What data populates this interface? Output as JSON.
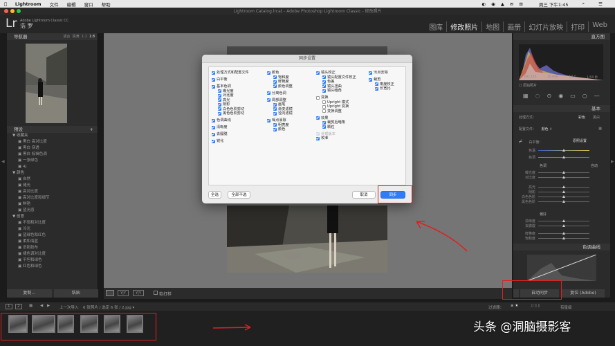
{
  "menubar": {
    "app": "Lightroom",
    "items": [
      "文件",
      "编辑",
      "窗口",
      "帮助"
    ],
    "clock": "周三 下午1:45"
  },
  "window": {
    "title": "Lightroom Catalog.lrcat - Adobe Photoshop Lightroom Classic - 修改照片"
  },
  "identity": {
    "logo": "Lr",
    "product": "Adobe Lightroom Classic CC",
    "user": "浩 罗"
  },
  "modules": [
    "图库",
    "修改照片",
    "地图",
    "画册",
    "幻灯片放映",
    "打印",
    "Web"
  ],
  "left_panel": {
    "navigator_label": "导航器",
    "navigator_zoom": [
      "适合",
      "填满",
      "1:1",
      "1:8"
    ],
    "presets_label": "预设",
    "preset_groups": [
      {
        "name": "收藏夹",
        "items": [
          "黑白 高对比度",
          "黑白 穿透",
          "黑白 棕褐色调",
          "一张绿色",
          "4J"
        ]
      },
      {
        "name": "颜色",
        "items": [
          "自然",
          "褪光",
          "高对比度",
          "高对比度和细节",
          "鲜艳",
          "蓝光感"
        ]
      },
      {
        "name": "创意",
        "items": [
          "不饱和对比度",
          "冷光",
          "蓝绿色和红色",
          "柔和海蓝",
          "旧影胶布",
          "褪色调对比度",
          "平坦和绿色",
          "红色和绿色"
        ]
      }
    ],
    "copy_btn": "复制...",
    "paste_btn": "粘贴"
  },
  "toolbar": {
    "soft_proof": "软打样"
  },
  "right_panel": {
    "histogram_label": "直方图",
    "histo_info": [
      "ISO 125",
      "35 mm",
      "f/4.0",
      "1/50 秒"
    ],
    "original_photo": "原始照片",
    "basic_label": "基本",
    "treatment": "处理方式：",
    "treatment_opts": [
      "彩色",
      "黑白"
    ],
    "profile_label": "配置文件：",
    "profile_value": "颜色",
    "wb_label": "白平衡：",
    "wb_value": "原照设置",
    "tone_label": "色调",
    "tone_auto": "自动",
    "presence_label": "偏好",
    "sliders": [
      "色温",
      "色调",
      "曝光度",
      "对比度",
      "高光",
      "阴影",
      "白色色阶",
      "黑色色阶",
      "清晰度",
      "去朦胧",
      "鲜艳度",
      "饱和度"
    ],
    "tone_curve_label": "色调曲线",
    "auto_sync_btn": "自动同步",
    "reset_btn": "复位 (Adobe)"
  },
  "filmstrip_bar": {
    "pages": [
      "1",
      "2"
    ],
    "source": "上一次导入",
    "count": "6 张照片 / 选定 6 张 / 2.jpg ▾",
    "filter_label": "过滤器：",
    "filter_value": "有星级"
  },
  "dialog": {
    "title": "同步设置",
    "col1": [
      {
        "label": "处理方式和配置文件",
        "checked": true,
        "indent": 0
      },
      {
        "label": "白平衡",
        "checked": true,
        "indent": 0
      },
      {
        "label": "基本色调",
        "checked": true,
        "indent": 0
      },
      {
        "label": "曝光度",
        "checked": true,
        "indent": 1
      },
      {
        "label": "对比度",
        "checked": true,
        "indent": 1
      },
      {
        "label": "高光",
        "checked": true,
        "indent": 1
      },
      {
        "label": "阴影",
        "checked": true,
        "indent": 1
      },
      {
        "label": "白色色阶剪切",
        "checked": true,
        "indent": 1
      },
      {
        "label": "黑色色阶剪切",
        "checked": true,
        "indent": 1
      },
      {
        "label": "色调曲线",
        "checked": true,
        "indent": 0
      },
      {
        "label": "清晰度",
        "checked": true,
        "indent": 0
      },
      {
        "label": "去朦胧",
        "checked": true,
        "indent": 0
      },
      {
        "label": "锐化",
        "checked": true,
        "indent": 0
      }
    ],
    "col2": [
      {
        "label": "颜色",
        "checked": true,
        "indent": 0
      },
      {
        "label": "饱和度",
        "checked": true,
        "indent": 1
      },
      {
        "label": "鲜艳度",
        "checked": true,
        "indent": 1
      },
      {
        "label": "颜色调整",
        "checked": true,
        "indent": 1
      },
      {
        "label": "分离色调",
        "checked": true,
        "indent": 0
      },
      {
        "label": "局部调整",
        "checked": true,
        "indent": 0
      },
      {
        "label": "画笔",
        "checked": true,
        "indent": 1
      },
      {
        "label": "渐变滤镜",
        "checked": true,
        "indent": 1
      },
      {
        "label": "径向滤镜",
        "checked": true,
        "indent": 1
      },
      {
        "label": "噪点消除",
        "checked": true,
        "indent": 0
      },
      {
        "label": "明亮度",
        "checked": true,
        "indent": 1
      },
      {
        "label": "颜色",
        "checked": true,
        "indent": 1
      }
    ],
    "col3": [
      {
        "label": "镜头校正",
        "checked": true,
        "indent": 0,
        "state": "on"
      },
      {
        "label": "镜头配置文件校正",
        "checked": true,
        "indent": 1,
        "state": "on"
      },
      {
        "label": "色差",
        "checked": true,
        "indent": 1,
        "state": "on"
      },
      {
        "label": "镜头扭曲",
        "checked": true,
        "indent": 1,
        "state": "on"
      },
      {
        "label": "镜头暗角",
        "checked": true,
        "indent": 1,
        "state": "on"
      },
      {
        "label": "变换",
        "checked": false,
        "indent": 0,
        "state": "off"
      },
      {
        "label": "Upright 模式",
        "checked": false,
        "indent": 1,
        "state": "off"
      },
      {
        "label": "Upright 变换",
        "checked": false,
        "indent": 1,
        "state": "off"
      },
      {
        "label": "变换调整",
        "checked": false,
        "indent": 1,
        "state": "off"
      },
      {
        "label": "效果",
        "checked": true,
        "indent": 0,
        "state": "on"
      },
      {
        "label": "裁剪后暗角",
        "checked": true,
        "indent": 1,
        "state": "on"
      },
      {
        "label": "颗粒",
        "checked": true,
        "indent": 1,
        "state": "on"
      },
      {
        "label": "处理版本",
        "checked": true,
        "indent": 0,
        "state": "dis"
      },
      {
        "label": "校准",
        "checked": true,
        "indent": 0,
        "state": "on"
      }
    ],
    "col4": [
      {
        "label": "污点去除",
        "checked": true,
        "indent": 0
      },
      {
        "label": "裁剪",
        "checked": true,
        "indent": 0
      },
      {
        "label": "角度校正",
        "checked": true,
        "indent": 1
      },
      {
        "label": "长宽比",
        "checked": true,
        "indent": 1
      }
    ],
    "btn_select_all": "全选",
    "btn_select_none": "全部不选",
    "btn_cancel": "取消",
    "btn_sync": "同步"
  },
  "watermark": "头条 @洞脑摄影客"
}
